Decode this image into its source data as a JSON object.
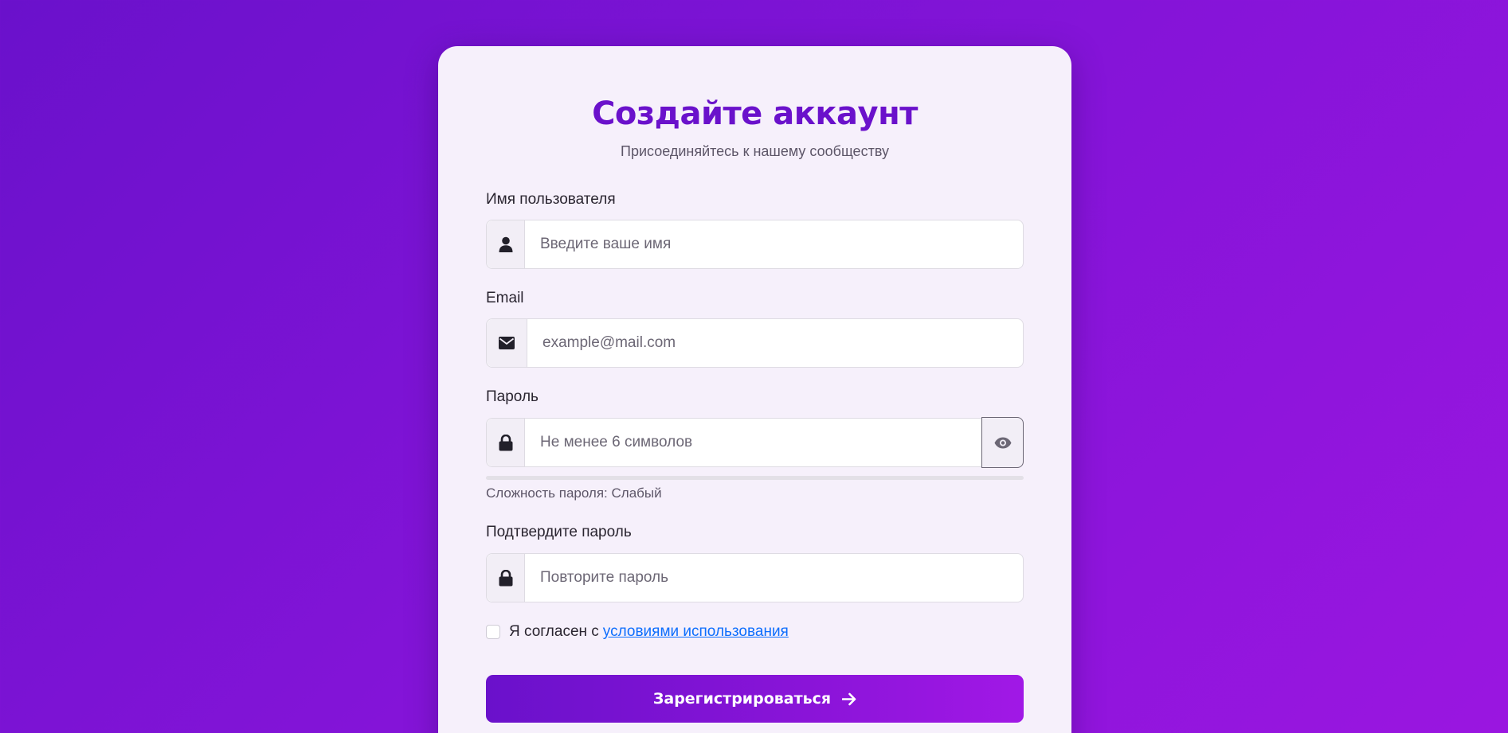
{
  "form": {
    "title": "Создайте аккаунт",
    "subtitle": "Присоединяйтесь к нашему сообществу"
  },
  "username": {
    "label": "Имя пользователя",
    "placeholder": "Введите ваше имя",
    "value": "",
    "icon": "user-icon"
  },
  "email": {
    "label": "Email",
    "placeholder": "example@mail.com",
    "value": "",
    "icon": "envelope-icon"
  },
  "password": {
    "label": "Пароль",
    "placeholder": "Не менее 6 символов",
    "value": "",
    "icon": "lock-icon",
    "toggle_icon": "eye-icon",
    "strength_text": "Сложность пароля: Слабый",
    "strength_level": 0
  },
  "confirm_password": {
    "label": "Подтвердите пароль",
    "placeholder": "Повторите пароль",
    "value": "",
    "icon": "lock-icon"
  },
  "terms": {
    "checked": false,
    "text": "Я согласен с",
    "link_text": "условиями использования"
  },
  "submit": {
    "label": "Зарегистрироваться",
    "icon": "arrow-right-icon"
  },
  "colors": {
    "accent": "#6a11cb",
    "accent_end": "#a118e6",
    "card_background": "#f6f0fb",
    "link": "#0d6efd"
  }
}
